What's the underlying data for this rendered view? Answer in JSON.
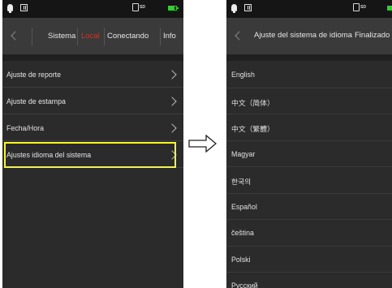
{
  "left_screen": {
    "tabs": [
      {
        "label": "Sistema"
      },
      {
        "label": "Local"
      },
      {
        "label": "Conectando"
      },
      {
        "label": "Info"
      }
    ],
    "sd_label": "SD",
    "menu": [
      {
        "label": "Ajuste de reporte"
      },
      {
        "label": "Ajuste de estampa"
      },
      {
        "label": "Fecha/Hora"
      },
      {
        "label": "Ajustes idioma del sistema"
      }
    ],
    "highlight_color": "#f5f542",
    "active_tab_color": "#c0392b"
  },
  "right_screen": {
    "title": "Ajuste del sistema de idioma",
    "finish_label": "Finalizado",
    "sd_label": "SD",
    "languages": [
      {
        "label": "English"
      },
      {
        "label": "中文（简体）"
      },
      {
        "label": "中文（繁體）"
      },
      {
        "label": "Magyar"
      },
      {
        "label": "한국의"
      },
      {
        "label": "Español"
      },
      {
        "label": "čeština"
      },
      {
        "label": "Polski"
      },
      {
        "label": "Русский"
      }
    ]
  }
}
